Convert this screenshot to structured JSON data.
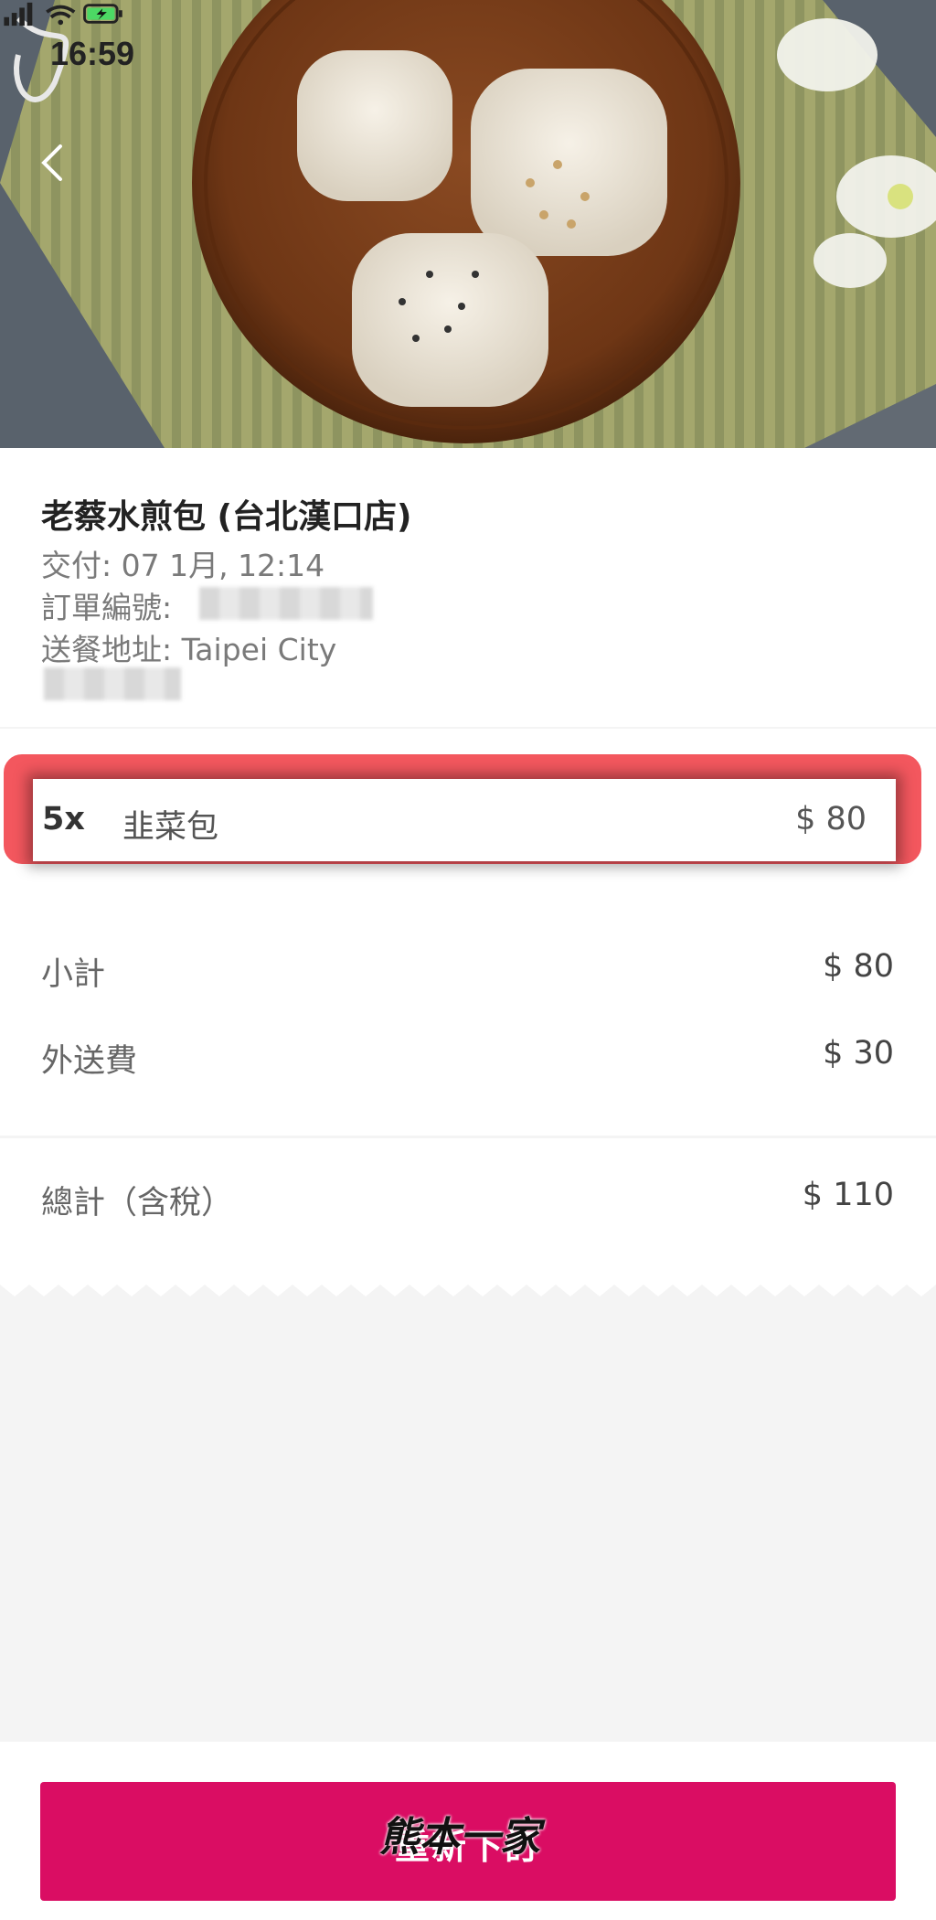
{
  "status_bar": {
    "time": "16:59"
  },
  "order": {
    "store_name": "老蔡水煎包 (台北漢口店)",
    "delivery": "交付: 07 1月, 12:14",
    "order_number_label": "訂單編號:",
    "address": "送餐地址: Taipei City"
  },
  "items": [
    {
      "qty": "5x",
      "name": "韭菜包",
      "price": "$ 80"
    }
  ],
  "summary": {
    "subtotal_label": "小計",
    "subtotal_value": "$ 80",
    "delivery_fee_label": "外送費",
    "delivery_fee_value": "$ 30",
    "total_label": "總計（含稅）",
    "total_value": "$ 110"
  },
  "actions": {
    "reorder_label": "重新下訂"
  },
  "watermark": "熊本一家",
  "colors": {
    "accent": "#da0d63",
    "highlight": "#f3575e"
  }
}
